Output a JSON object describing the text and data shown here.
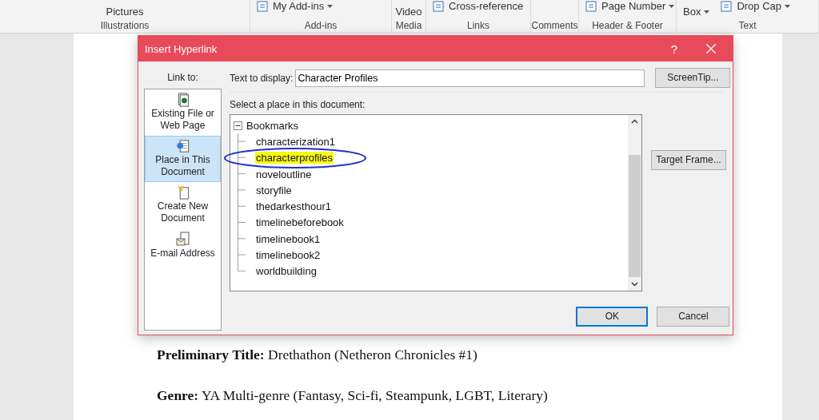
{
  "ribbon": {
    "groups": [
      {
        "label": "Illustrations",
        "items": [
          {
            "text": "Pictures",
            "kind": "plain"
          }
        ]
      },
      {
        "label": "Add-ins",
        "items": [
          {
            "text": "My Add-ins",
            "kind": "icon-dropdown"
          }
        ]
      },
      {
        "label": "Media",
        "items": [
          {
            "text": "Video",
            "kind": "plain"
          }
        ]
      },
      {
        "label": "Links",
        "items": [
          {
            "text": "Cross-reference",
            "kind": "icon"
          }
        ]
      },
      {
        "label": "Comments"
      },
      {
        "label": "Header & Footer",
        "items": [
          {
            "text": "Page Number",
            "kind": "icon-dropdown"
          }
        ]
      },
      {
        "label": "Text",
        "items": [
          {
            "text": "Box",
            "kind": "dropdown"
          },
          {
            "text": "Drop Cap",
            "kind": "icon-dropdown"
          }
        ]
      }
    ]
  },
  "document": {
    "paragraphs": [
      "**Preliminary Title:** Drethathon (Netheron Chronicles #1)",
      "**Genre:** YA Multi-genre (Fantasy, Sci-fi, Steampunk, LGBT, Literary)"
    ]
  },
  "dialog": {
    "title": "Insert Hyperlink",
    "help": "?",
    "link_to": {
      "label": "Link to:",
      "items": [
        {
          "text": "Existing File or Web Page",
          "kind": "file",
          "selected": false
        },
        {
          "text": "Place in This Document",
          "kind": "place",
          "selected": true
        },
        {
          "text": "Create New Document",
          "kind": "new",
          "selected": false
        },
        {
          "text": "E-mail Address",
          "kind": "email",
          "selected": false
        }
      ]
    },
    "text_to_display": {
      "label": "Text to display:",
      "value": "Character Profiles"
    },
    "place_label": "Select a place in this document:",
    "tree": {
      "label": "Bookmarks",
      "expanded": true,
      "children": [
        {
          "label": "characterization1",
          "highlighted": false
        },
        {
          "label": "characterprofiles",
          "highlighted": true,
          "circled": true
        },
        {
          "label": "noveloutline",
          "highlighted": false
        },
        {
          "label": "storyfile",
          "highlighted": false
        },
        {
          "label": "thedarkesthour1",
          "highlighted": false
        },
        {
          "label": "timelinebeforebook",
          "highlighted": false
        },
        {
          "label": "timelinebook1",
          "highlighted": false
        },
        {
          "label": "timelinebook2",
          "highlighted": false
        },
        {
          "label": "worldbuilding",
          "highlighted": false
        }
      ]
    },
    "buttons": {
      "screentip": "ScreenTip...",
      "target_frame": "Target Frame...",
      "ok": "OK",
      "cancel": "Cancel"
    }
  }
}
